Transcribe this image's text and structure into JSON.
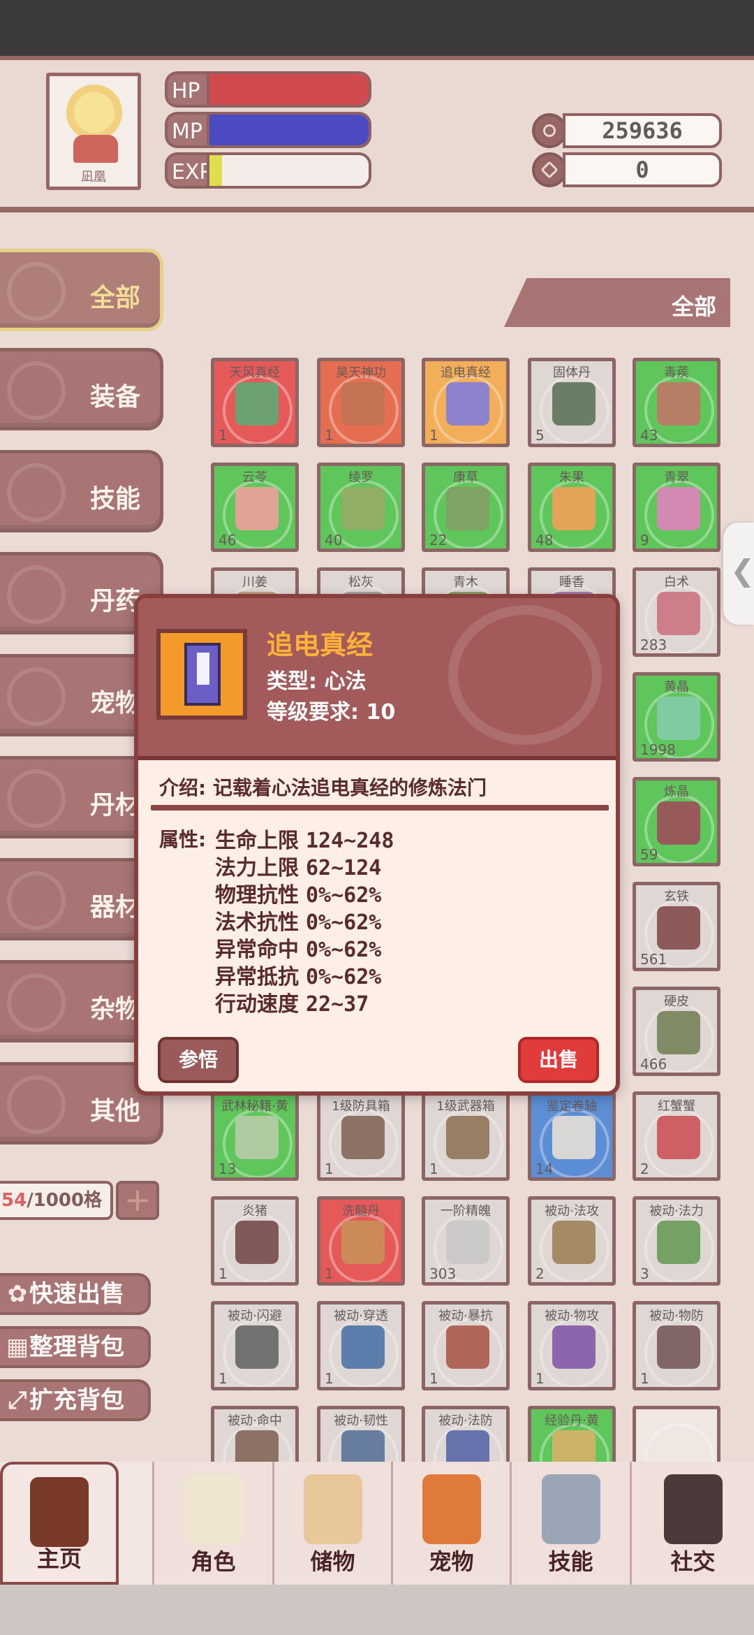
{
  "header": {
    "portrait_name": "凪凰",
    "hp_label": "HP",
    "mp_label": "MP",
    "exp_label": "EXP",
    "hp_fraction": 1.0,
    "mp_fraction": 1.0,
    "exp_fraction": 0.08,
    "coins": "259636",
    "gems": "0"
  },
  "sidebar": {
    "categories": [
      "全部",
      "装备",
      "技能",
      "丹药",
      "宠物",
      "丹材",
      "器材",
      "杂物",
      "其他"
    ],
    "capacity_used": "54",
    "capacity_total": "/1000格",
    "plus": "+",
    "actions": {
      "quick_sell": "快速出售",
      "sort_bag": "整理背包",
      "expand_bag": "扩充背包"
    }
  },
  "filter_tab": "全部",
  "items": [
    {
      "name": "天风真经",
      "qty": "1",
      "bg": "#e02a2a",
      "art": "#3f8a4a"
    },
    {
      "name": "昊天神功",
      "qty": "1",
      "bg": "#e0441f",
      "art": "#b34a22"
    },
    {
      "name": "追电真经",
      "qty": "1",
      "bg": "#f39a2a",
      "art": "#6b5fc6"
    },
    {
      "name": "固体丹",
      "qty": "5",
      "bg": "#d9d0cc",
      "art": "#3b5a3a"
    },
    {
      "name": "毒蒺",
      "qty": "43",
      "bg": "#2dba2d",
      "art": "#a05a3a"
    },
    {
      "name": "云苓",
      "qty": "46",
      "bg": "#2dba2d",
      "art": "#d98c7a"
    },
    {
      "name": "绫罗",
      "qty": "40",
      "bg": "#2dba2d",
      "art": "#6f9a3a"
    },
    {
      "name": "康草",
      "qty": "22",
      "bg": "#2dba2d",
      "art": "#5a8a3a"
    },
    {
      "name": "朱果",
      "qty": "48",
      "bg": "#2dba2d",
      "art": "#e08a2a"
    },
    {
      "name": "青翠",
      "qty": "9",
      "bg": "#2dba2d",
      "art": "#c86aa0"
    },
    {
      "name": "川姜",
      "qty": "",
      "bg": "#d9d0cc",
      "art": "#b38a5a"
    },
    {
      "name": "松灰",
      "qty": "",
      "bg": "#d9d0cc",
      "art": "#8a8a8a"
    },
    {
      "name": "青木",
      "qty": "",
      "bg": "#d9d0cc",
      "art": "#5a8a3a"
    },
    {
      "name": "睡香",
      "qty": "",
      "bg": "#d9d0cc",
      "art": "#8a5aa0"
    },
    {
      "name": "白术",
      "qty": "283",
      "bg": "#d9d0cc",
      "art": "#c05a6a"
    },
    {
      "name": "",
      "qty": "",
      "bg": "#d9d0cc",
      "art": "#d9d0cc"
    },
    {
      "name": "",
      "qty": "",
      "bg": "#d9d0cc",
      "art": "#d9d0cc"
    },
    {
      "name": "",
      "qty": "",
      "bg": "#d9d0cc",
      "art": "#d9d0cc"
    },
    {
      "name": "",
      "qty": "",
      "bg": "#d9d0cc",
      "art": "#d9d0cc"
    },
    {
      "name": "黄晶",
      "qty": "1998",
      "bg": "#2dba2d",
      "art": "#5ac08a"
    },
    {
      "name": "",
      "qty": "",
      "bg": "#d9d0cc",
      "art": "#d9d0cc"
    },
    {
      "name": "",
      "qty": "",
      "bg": "#d9d0cc",
      "art": "#d9d0cc"
    },
    {
      "name": "",
      "qty": "",
      "bg": "#d9d0cc",
      "art": "#d9d0cc"
    },
    {
      "name": "",
      "qty": "",
      "bg": "#d9d0cc",
      "art": "#d9d0cc"
    },
    {
      "name": "炼晶",
      "qty": "59",
      "bg": "#2dba2d",
      "art": "#7a2a2a"
    },
    {
      "name": "",
      "qty": "",
      "bg": "#d9d0cc",
      "art": "#d9d0cc"
    },
    {
      "name": "",
      "qty": "",
      "bg": "#d9d0cc",
      "art": "#d9d0cc"
    },
    {
      "name": "",
      "qty": "",
      "bg": "#d9d0cc",
      "art": "#d9d0cc"
    },
    {
      "name": "",
      "qty": "",
      "bg": "#d9d0cc",
      "art": "#d9d0cc"
    },
    {
      "name": "玄铁",
      "qty": "561",
      "bg": "#d9d0cc",
      "art": "#6a2a2a"
    },
    {
      "name": "",
      "qty": "",
      "bg": "#d9d0cc",
      "art": "#d9d0cc"
    },
    {
      "name": "",
      "qty": "",
      "bg": "#d9d0cc",
      "art": "#d9d0cc"
    },
    {
      "name": "",
      "qty": "",
      "bg": "#d9d0cc",
      "art": "#d9d0cc"
    },
    {
      "name": "",
      "qty": "",
      "bg": "#d9d0cc",
      "art": "#d9d0cc"
    },
    {
      "name": "硬皮",
      "qty": "466",
      "bg": "#d9d0cc",
      "art": "#5a6a3a"
    },
    {
      "name": "武林秘籍·黄",
      "qty": "13",
      "bg": "#2dba2d",
      "art": "#9ac08a"
    },
    {
      "name": "1级防具箱",
      "qty": "1",
      "bg": "#d9d0cc",
      "art": "#6a4a3a"
    },
    {
      "name": "1级武器箱",
      "qty": "1",
      "bg": "#d9d0cc",
      "art": "#7a5a3a"
    },
    {
      "name": "鉴定卷轴",
      "qty": "14",
      "bg": "#2a6fd0",
      "art": "#d0d0d0"
    },
    {
      "name": "红蟹蟹",
      "qty": "2",
      "bg": "#d9d0cc",
      "art": "#c0303a"
    },
    {
      "name": "炎猪",
      "qty": "1",
      "bg": "#d9d0cc",
      "art": "#5a2a2a"
    },
    {
      "name": "洗髓丹",
      "qty": "1",
      "bg": "#e02a2a",
      "art": "#c06a2a"
    },
    {
      "name": "一阶精魄",
      "qty": "303",
      "bg": "#d9d0cc",
      "art": "#bfbfbf"
    },
    {
      "name": "被动·法攻",
      "qty": "2",
      "bg": "#d9d0cc",
      "art": "#8a6a3a"
    },
    {
      "name": "被动·法力",
      "qty": "3",
      "bg": "#d9d0cc",
      "art": "#4a8a3a"
    },
    {
      "name": "被动·闪避",
      "qty": "1",
      "bg": "#d9d0cc",
      "art": "#4a4a4a"
    },
    {
      "name": "被动·穿透",
      "qty": "1",
      "bg": "#d9d0cc",
      "art": "#2a5a9a"
    },
    {
      "name": "被动·暴抗",
      "qty": "1",
      "bg": "#d9d0cc",
      "art": "#9a3a2a"
    },
    {
      "name": "被动·物攻",
      "qty": "1",
      "bg": "#d9d0cc",
      "art": "#6a3a9a"
    },
    {
      "name": "被动·物防",
      "qty": "1",
      "bg": "#d9d0cc",
      "art": "#5a3a3a"
    },
    {
      "name": "被动·命中",
      "qty": "",
      "bg": "#d9d0cc",
      "art": "#6a4a3a"
    },
    {
      "name": "被动·韧性",
      "qty": "",
      "bg": "#d9d0cc",
      "art": "#3a5a8a"
    },
    {
      "name": "被动·法防",
      "qty": "",
      "bg": "#d9d0cc",
      "art": "#3a4a9a"
    },
    {
      "name": "经验丹·黄",
      "qty": "",
      "bg": "#2dba2d",
      "art": "#c0a03a"
    },
    {
      "name": "",
      "qty": "",
      "bg": "#efe6e2",
      "art": "#efe6e2"
    }
  ],
  "modal": {
    "title": "追电真经",
    "type_line": "类型: 心法",
    "level_line": "等级要求: 10",
    "desc": "介绍: 记载着心法追电真经的修炼法门",
    "attr_label": "属性:",
    "attributes": [
      {
        "name": "生命上限",
        "value": "124~248"
      },
      {
        "name": "法力上限",
        "value": "62~124"
      },
      {
        "name": "物理抗性",
        "value": "0%~62%"
      },
      {
        "name": "法术抗性",
        "value": "0%~62%"
      },
      {
        "name": "异常命中",
        "value": "0%~62%"
      },
      {
        "name": "异常抵抗",
        "value": "0%~62%"
      },
      {
        "name": "行动速度",
        "value": "22~37"
      }
    ],
    "comprehend_label": "参悟",
    "sell_label": "出售"
  },
  "nav": [
    "主页",
    "角色",
    "储物",
    "宠物",
    "技能",
    "社交"
  ],
  "colors": {
    "hp": "#c4141b",
    "mp": "#1515b5",
    "exp": "#d8d81e",
    "accent": "#8f4e4e",
    "sell": "#e23b3b",
    "title": "#ffb23a"
  },
  "icons": {
    "coins": "coin-icon",
    "gems": "gem-icon",
    "quick_sell": "money-bag-icon",
    "sort_bag": "grid-icon",
    "expand_bag": "expand-icon",
    "side_handle": "chevron-left-icon"
  }
}
